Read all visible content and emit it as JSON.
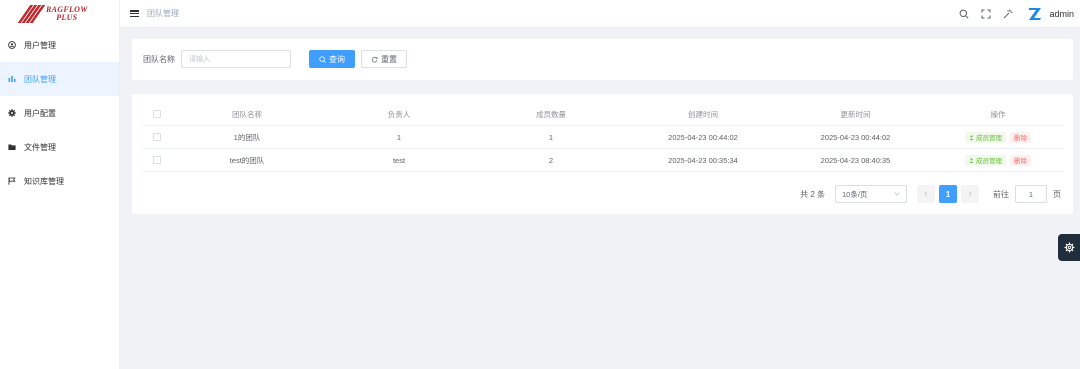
{
  "brand": {
    "line1": "RAGFLOW",
    "line2": "PLUS",
    "color": "#c0282d"
  },
  "sidebar": {
    "items": [
      {
        "label": "用户管理",
        "icon": "user-circle-icon",
        "active": false
      },
      {
        "label": "团队管理",
        "icon": "team-chart-icon",
        "active": true
      },
      {
        "label": "用户配置",
        "icon": "gear-icon",
        "active": false
      },
      {
        "label": "文件管理",
        "icon": "folder-icon",
        "active": false
      },
      {
        "label": "知识库管理",
        "icon": "flag-icon",
        "active": false
      }
    ]
  },
  "header": {
    "breadcrumb": "团队管理",
    "user_name": "admin",
    "icons": [
      "search-icon",
      "fullscreen-icon",
      "theme-icon"
    ]
  },
  "search": {
    "label": "团队名称",
    "placeholder": "请输入",
    "value": "",
    "search_label": "查询",
    "reset_label": "重置"
  },
  "table": {
    "columns": [
      "团队名称",
      "负责人",
      "成员数量",
      "创建时间",
      "更新时间",
      "操作"
    ],
    "rows": [
      {
        "name": "1的团队",
        "owner": "1",
        "count": "1",
        "created": "2025-04-23 00:44:02",
        "updated": "2025-04-23 00:44:02",
        "member_btn": "成员管理",
        "delete_btn": "删除"
      },
      {
        "name": "test的团队",
        "owner": "test",
        "count": "2",
        "created": "2025-04-23 00:35:34",
        "updated": "2025-04-23 08:40:35",
        "member_btn": "成员管理",
        "delete_btn": "删除"
      }
    ]
  },
  "pagination": {
    "total": "共 2 条",
    "page_size": "10条/页",
    "current_page": "1",
    "goto_label": "前往",
    "goto_value": "1",
    "page_suffix": "页"
  },
  "colors": {
    "primary": "#409eff",
    "success": "#67c23a",
    "danger": "#f56c6c",
    "background": "#f0f2f5"
  }
}
